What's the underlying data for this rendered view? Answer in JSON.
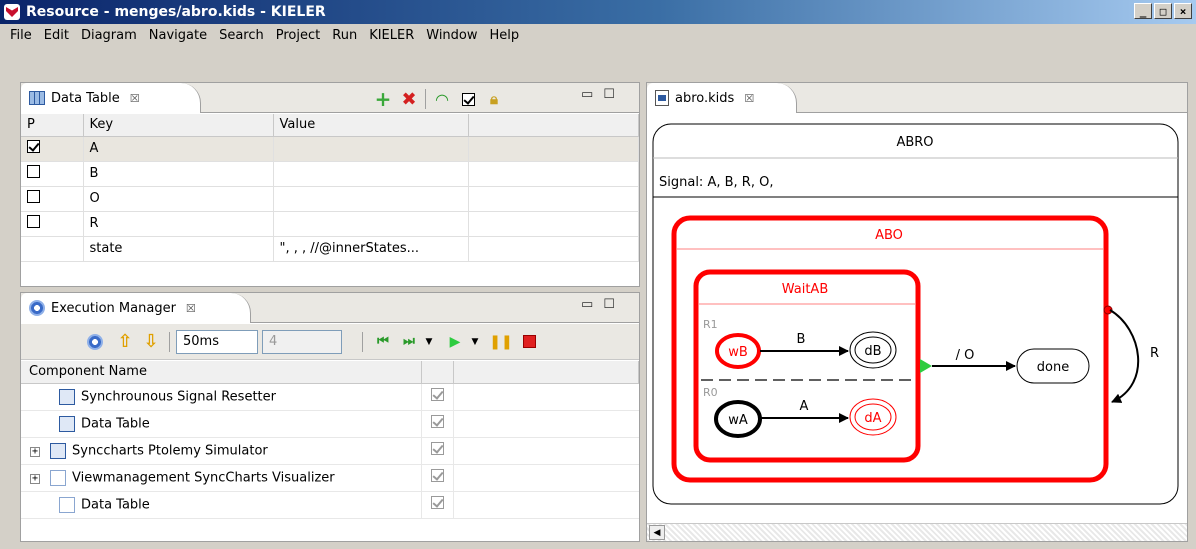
{
  "window": {
    "title": "Resource - menges/abro.kids - KIELER",
    "btn_min": "_",
    "btn_max": "□",
    "btn_close": "×"
  },
  "menu": [
    "File",
    "Edit",
    "Diagram",
    "Navigate",
    "Search",
    "Project",
    "Run",
    "KIELER",
    "Window",
    "Help"
  ],
  "data_table": {
    "tab_label": "Data Table",
    "close_glyph": "☒",
    "columns": [
      "P",
      "Key",
      "Value"
    ],
    "rows": [
      {
        "key": "A",
        "value": "",
        "checked": true
      },
      {
        "key": "B",
        "value": "",
        "checked": false
      },
      {
        "key": "O",
        "value": "",
        "checked": false
      },
      {
        "key": "R",
        "value": "",
        "checked": false
      },
      {
        "key": "state",
        "value": "\", , , //@innerStates...",
        "checked": null
      }
    ]
  },
  "execution_manager": {
    "tab_label": "Execution Manager",
    "close_glyph": "☒",
    "interval_value": "50ms",
    "step_value": "4",
    "column": "Component Name",
    "components": [
      {
        "name": "Synchrounous Signal Resetter",
        "expandable": false,
        "enabled": true
      },
      {
        "name": "Data Table",
        "expandable": false,
        "enabled": true
      },
      {
        "name": "Synccharts Ptolemy Simulator",
        "expandable": true,
        "enabled": true
      },
      {
        "name": "Viewmanagement SyncCharts Visualizer",
        "expandable": true,
        "enabled": true
      },
      {
        "name": "Data Table",
        "expandable": false,
        "enabled": true
      }
    ]
  },
  "editor": {
    "tab_label": "abro.kids",
    "close_glyph": "☒",
    "diagram": {
      "root_name": "ABRO",
      "signals": "Signal: A, B, R, O,",
      "macro_state": "ABO",
      "inner_state": "WaitAB",
      "region_label_1": "R1",
      "region_label_0": "R0",
      "states": {
        "wB": "wB",
        "dB": "dB",
        "wA": "wA",
        "dA": "dA",
        "done": "done"
      },
      "transition_labels": {
        "b": "B",
        "a": "A",
        "o": "/ O",
        "r": "R"
      },
      "colors": {
        "active": "#ff0000",
        "inactive": "#000000",
        "initial_marker": "#2ecc40"
      }
    }
  }
}
